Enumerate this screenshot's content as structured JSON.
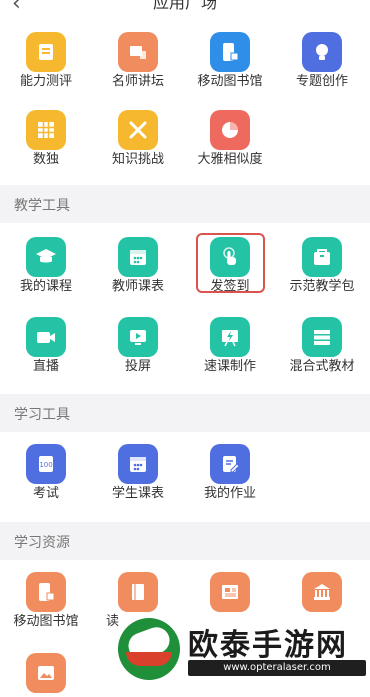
{
  "header": {
    "back_icon": "chevron-left-icon",
    "title": "应用广场"
  },
  "rows": [
    {
      "items": [
        {
          "label": "能力测评",
          "color": "#f5b82e",
          "icon": "book-icon"
        },
        {
          "label": "名师讲坛",
          "color": "#f08c5d",
          "icon": "podium-icon"
        },
        {
          "label": "移动图书馆",
          "color": "#2e8ee8",
          "icon": "mobile-library-icon"
        },
        {
          "label": "专题创作",
          "color": "#4f6fe0",
          "icon": "lightbulb-icon"
        }
      ]
    },
    {
      "items": [
        {
          "label": "数独",
          "color": "#f5b82e",
          "icon": "grid-icon"
        },
        {
          "label": "知识挑战",
          "color": "#f5b82e",
          "icon": "swords-icon"
        },
        {
          "label": "大雅相似度",
          "color": "#ee6a5e",
          "icon": "pie-icon"
        }
      ]
    }
  ],
  "sections": {
    "teaching_tools": "教学工具",
    "study_tools": "学习工具",
    "study_resources": "学习资源"
  },
  "teaching": [
    {
      "label": "我的课程",
      "color": "#24c3a6",
      "icon": "graduation-cap-icon"
    },
    {
      "label": "教师课表",
      "color": "#24c3a6",
      "icon": "calendar-icon"
    },
    {
      "label": "发签到",
      "color": "#24c3a6",
      "icon": "tap-hand-icon"
    },
    {
      "label": "示范教学包",
      "color": "#24c3a6",
      "icon": "package-icon"
    },
    {
      "label": "直播",
      "color": "#24c3a6",
      "icon": "video-camera-icon"
    },
    {
      "label": "投屏",
      "color": "#24c3a6",
      "icon": "screen-play-icon"
    },
    {
      "label": "速课制作",
      "color": "#24c3a6",
      "icon": "lightning-board-icon"
    },
    {
      "label": "混合式教材",
      "color": "#24c3a6",
      "icon": "books-stack-icon"
    }
  ],
  "study": [
    {
      "label": "考试",
      "color": "#4f6fe0",
      "icon": "exam-100-icon"
    },
    {
      "label": "学生课表",
      "color": "#4f6fe0",
      "icon": "calendar-icon"
    },
    {
      "label": "我的作业",
      "color": "#4f6fe0",
      "icon": "homework-pen-icon"
    }
  ],
  "resources": [
    {
      "label": "移动图书馆",
      "color": "#f08c5d",
      "icon": "mobile-library-icon"
    },
    {
      "label": "读",
      "color": "#f08c5d",
      "icon": "book-icon"
    },
    {
      "label": "",
      "color": "#f08c5d",
      "icon": "newspaper-icon"
    },
    {
      "label": "",
      "color": "#f08c5d",
      "icon": "museum-icon"
    }
  ],
  "watermark": {
    "brand": "欧泰手游网",
    "url": "www.opteralaser.com"
  }
}
